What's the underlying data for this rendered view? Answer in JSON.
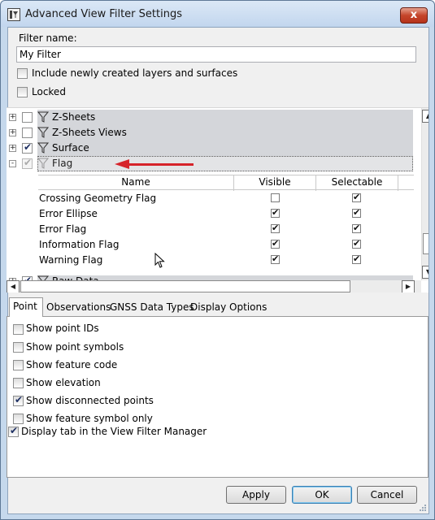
{
  "window": {
    "title": "Advanced View Filter Settings",
    "close_glyph": "x",
    "icon": "filter-settings-icon"
  },
  "filter": {
    "name_label": "Filter name:",
    "name_value": "My Filter",
    "include_new_label": "Include newly created layers and surfaces",
    "include_new_checked": false,
    "locked_label": "Locked",
    "locked_checked": false
  },
  "tree": {
    "nodes": [
      {
        "label": "Z-Sheets",
        "checked": false,
        "expander": "+"
      },
      {
        "label": "Z-Sheets Views",
        "checked": false,
        "expander": "+"
      },
      {
        "label": "Surface",
        "checked": true,
        "expander": "+"
      },
      {
        "label": "Flag",
        "checked": true,
        "expander": "-",
        "selected": true
      },
      {
        "label": "Raw Data",
        "checked": true,
        "expander": "+"
      }
    ],
    "grid": {
      "columns": [
        "Name",
        "Visible",
        "Selectable"
      ],
      "rows": [
        {
          "name": "Crossing Geometry Flag",
          "visible": false,
          "selectable": true
        },
        {
          "name": "Error Ellipse",
          "visible": true,
          "selectable": true
        },
        {
          "name": "Error Flag",
          "visible": true,
          "selectable": true
        },
        {
          "name": "Information Flag",
          "visible": true,
          "selectable": true
        },
        {
          "name": "Warning Flag",
          "visible": true,
          "selectable": true
        }
      ]
    },
    "annotation_color": "#d6232a"
  },
  "tabs": {
    "items": [
      "Point",
      "Observations",
      "GNSS Data Types",
      "Display Options"
    ],
    "active": "Point"
  },
  "point_options": [
    {
      "label": "Show point IDs",
      "checked": false
    },
    {
      "label": "Show point symbols",
      "checked": false
    },
    {
      "label": "Show feature code",
      "checked": false
    },
    {
      "label": "Show elevation",
      "checked": false
    },
    {
      "label": "Show disconnected points",
      "checked": true
    },
    {
      "label": "Show feature symbol only",
      "checked": false
    }
  ],
  "display_tab": {
    "label": "Display tab in the View Filter Manager",
    "checked": true
  },
  "buttons": {
    "apply": "Apply",
    "ok": "OK",
    "cancel": "Cancel"
  }
}
